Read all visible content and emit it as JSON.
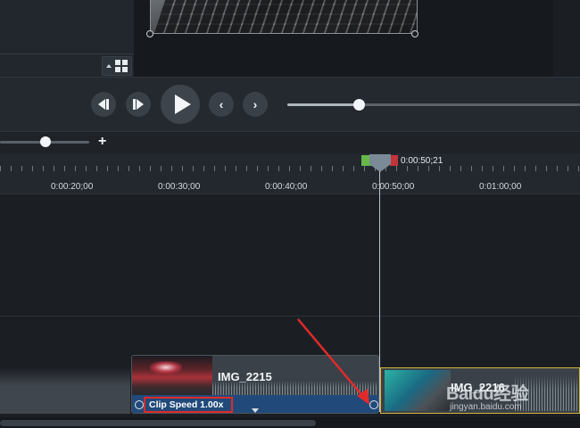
{
  "playback": {
    "prev_clip_label": "previous clip",
    "step_back_label": "step back",
    "play_label": "play",
    "prev_marker_label": "previous",
    "next_marker_label": "next"
  },
  "playback_progress_fraction": 0.25,
  "zoom": {
    "plus_label": "+",
    "level_fraction": 0.5
  },
  "ruler": {
    "labels": [
      "0:00:20;00",
      "0:00:30;00",
      "0:00:40;00",
      "0:00:50;00",
      "0:01:00;00"
    ]
  },
  "playhead": {
    "time": "0:00:50;21"
  },
  "timeline": {
    "clips": [
      {
        "name": "IMG_2215",
        "speed_label": "Clip Speed 1.00x"
      },
      {
        "name": "IMG_2216"
      }
    ]
  },
  "watermark": {
    "logo": "Baidu经验",
    "url": "jingyan.baidu.com"
  },
  "colors": {
    "accent_speed_bar": "#214a7a",
    "annotation_red": "#e02a2a",
    "selected_clip_border": "#d7b43a",
    "range_start": "#66b84a",
    "range_end": "#c4343b"
  }
}
